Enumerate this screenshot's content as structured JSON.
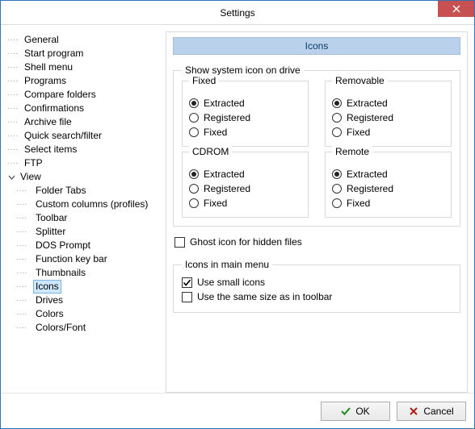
{
  "window": {
    "title": "Settings"
  },
  "tree": {
    "items": [
      {
        "label": "General",
        "depth": 0
      },
      {
        "label": "Start program",
        "depth": 0
      },
      {
        "label": "Shell menu",
        "depth": 0
      },
      {
        "label": "Programs",
        "depth": 0
      },
      {
        "label": "Compare folders",
        "depth": 0
      },
      {
        "label": "Confirmations",
        "depth": 0
      },
      {
        "label": "Archive file",
        "depth": 0
      },
      {
        "label": "Quick search/filter",
        "depth": 0
      },
      {
        "label": "Select items",
        "depth": 0
      },
      {
        "label": "FTP",
        "depth": 0
      },
      {
        "label": "View",
        "depth": 0,
        "expandable": true,
        "expanded": true
      },
      {
        "label": "Folder Tabs",
        "depth": 1
      },
      {
        "label": "Custom columns (profiles)",
        "depth": 1
      },
      {
        "label": "Toolbar",
        "depth": 1
      },
      {
        "label": "Splitter",
        "depth": 1
      },
      {
        "label": "DOS Prompt",
        "depth": 1
      },
      {
        "label": "Function key bar",
        "depth": 1
      },
      {
        "label": "Thumbnails",
        "depth": 1
      },
      {
        "label": "Icons",
        "depth": 1,
        "selected": true
      },
      {
        "label": "Drives",
        "depth": 1
      },
      {
        "label": "Colors",
        "depth": 1
      },
      {
        "label": "Colors/Font",
        "depth": 1
      }
    ]
  },
  "panel": {
    "title": "Icons",
    "driveGroup": {
      "legend": "Show system icon on drive",
      "optionLabels": [
        "Extracted",
        "Registered",
        "Fixed"
      ],
      "groups": [
        {
          "title": "Fixed",
          "selected": 0
        },
        {
          "title": "Removable",
          "selected": 0
        },
        {
          "title": "CDROM",
          "selected": 0
        },
        {
          "title": "Remote",
          "selected": 0
        }
      ]
    },
    "ghostIcon": {
      "label": "Ghost icon for hidden files",
      "checked": false
    },
    "menuIcons": {
      "legend": "Icons in main menu",
      "smallIcons": {
        "label": "Use small icons",
        "checked": true
      },
      "sameAsToolbar": {
        "label": "Use the same size as in toolbar",
        "checked": false
      }
    }
  },
  "footer": {
    "ok": "OK",
    "cancel": "Cancel"
  }
}
